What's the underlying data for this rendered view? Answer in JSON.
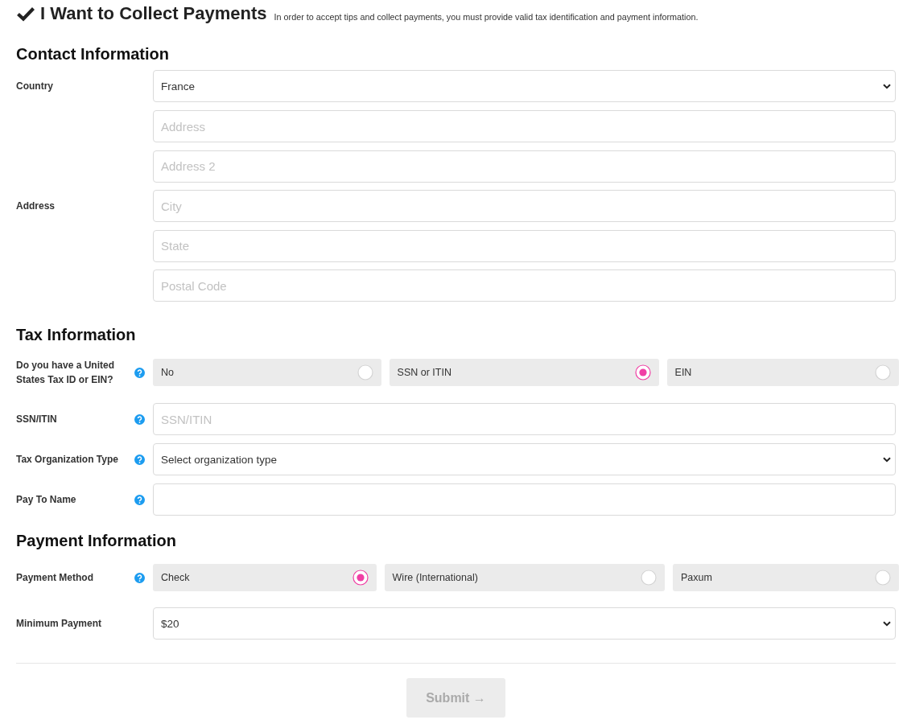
{
  "header": {
    "title": "I Want to Collect Payments",
    "description": "In order to accept tips and collect payments, you must provide valid tax identification and payment information."
  },
  "sections": [
    {
      "title": "Contact Information",
      "rows": [
        {
          "kind": "select",
          "label": "Country",
          "help": false,
          "value": "France"
        },
        {
          "kind": "inputs",
          "label": "Address",
          "help": false,
          "fields": [
            {
              "placeholder": "Address"
            },
            {
              "placeholder": "Address 2"
            },
            {
              "placeholder": "City"
            },
            {
              "placeholder": "State"
            },
            {
              "placeholder": "Postal Code"
            }
          ]
        }
      ]
    },
    {
      "title": "Tax Information",
      "rows": [
        {
          "kind": "radio",
          "label": "Do you have a United States Tax ID or EIN?",
          "help": true,
          "options": [
            {
              "label": "No",
              "selected": false
            },
            {
              "label": "SSN or ITIN",
              "selected": true
            },
            {
              "label": "EIN",
              "selected": false
            }
          ]
        },
        {
          "kind": "input",
          "label": "SSN/ITIN",
          "help": true,
          "placeholder": "SSN/ITIN"
        },
        {
          "kind": "select",
          "label": "Tax Organization Type",
          "help": true,
          "value": "Select organization type"
        },
        {
          "kind": "input",
          "label": "Pay To Name",
          "help": true
        }
      ]
    },
    {
      "title": "Payment Information",
      "rows": [
        {
          "kind": "radio",
          "label": "Payment Method",
          "help": true,
          "options": [
            {
              "label": "Check",
              "selected": true
            },
            {
              "label": "Wire (International)",
              "selected": false
            },
            {
              "label": "Paxum",
              "selected": false
            }
          ]
        },
        {
          "kind": "select",
          "label": "Minimum Payment",
          "help": false,
          "value": "$20"
        }
      ]
    }
  ],
  "submit": {
    "label": "Submit →",
    "disabled": true
  }
}
